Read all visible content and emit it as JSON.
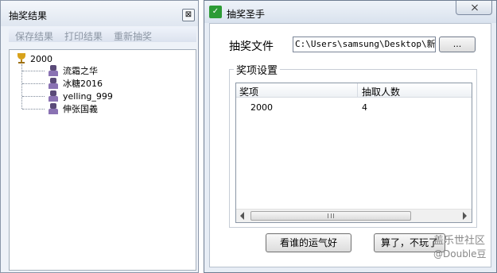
{
  "results_window": {
    "title": "抽奖结果",
    "close_glyph": "⊠",
    "menu": [
      "保存结果",
      "打印结果",
      "重新抽奖"
    ],
    "tree": {
      "root": "2000",
      "items": [
        "流霜之华",
        "冰糖2016",
        "yelling_999",
        "伸张国義"
      ]
    }
  },
  "app_window": {
    "title": "抽奖圣手",
    "icon_glyph": "✓",
    "file_label": "抽奖文件",
    "file_path": "C:\\Users\\samsung\\Desktop\\新建",
    "browse_label": "...",
    "group_label": "奖项设置",
    "table": {
      "headers": [
        "奖项",
        "抽取人数"
      ],
      "rows": [
        [
          "2000",
          "4"
        ]
      ]
    },
    "scrollbar_grip": "III",
    "lucky_button": "看谁的运气好",
    "quit_button": "算了，不玩了"
  },
  "watermark": {
    "line1": "盖乐世社区",
    "line2": "@Double豆"
  }
}
